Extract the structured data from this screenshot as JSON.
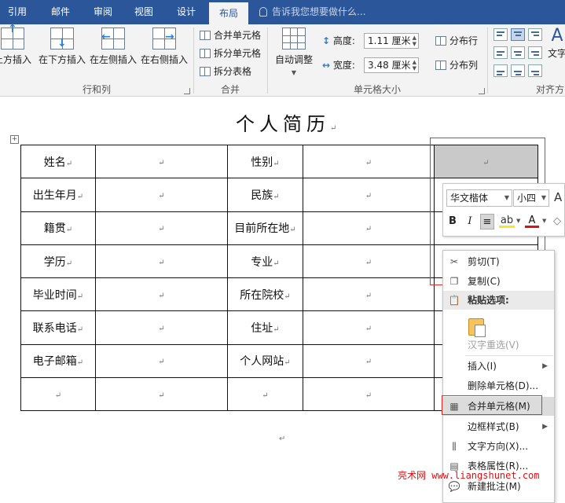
{
  "tabs": [
    "引用",
    "邮件",
    "审阅",
    "视图",
    "设计",
    "布局"
  ],
  "active_tab": "布局",
  "tell_me": "告诉我您想要做什么...",
  "ribbon": {
    "rows_cols": {
      "buttons": [
        "上方插入",
        "在下方插入",
        "在左侧插入",
        "在右侧插入"
      ],
      "label": "行和列"
    },
    "merge": {
      "items": [
        "合并单元格",
        "拆分单元格",
        "拆分表格"
      ],
      "label": "合并"
    },
    "cell_size": {
      "autofit": "自动调整",
      "height_label": "高度:",
      "height_value": "1.11 厘米",
      "width_label": "宽度:",
      "width_value": "3.48 厘米",
      "distribute_rows": "分布行",
      "distribute_cols": "分布列",
      "label": "单元格大小"
    },
    "alignment": {
      "text_direction": "文字",
      "label": "对齐方"
    }
  },
  "document": {
    "title": "个人简历",
    "para_mark": "↵",
    "table": [
      [
        "姓名",
        "",
        "性别",
        "",
        ""
      ],
      [
        "出生年月",
        "",
        "民族",
        "",
        ""
      ],
      [
        "籍贯",
        "",
        "目前所在地",
        "",
        ""
      ],
      [
        "学历",
        "",
        "专业",
        "",
        ""
      ],
      [
        "毕业时间",
        "",
        "所在院校",
        "",
        ""
      ],
      [
        "联系电话",
        "",
        "住址",
        "",
        ""
      ],
      [
        "电子邮箱",
        "",
        "个人网站",
        "",
        ""
      ],
      [
        "",
        "",
        "",
        "",
        ""
      ]
    ]
  },
  "mini_toolbar": {
    "font": "华文楷体",
    "size": "小四",
    "bold": "B",
    "italic": "I",
    "font_color": "A"
  },
  "context_menu": {
    "cut": "剪切(T)",
    "copy": "复制(C)",
    "paste_options": "粘贴选项:",
    "reconvert": "汉字重选(V)",
    "insert": "插入(I)",
    "delete_cells": "删除单元格(D)...",
    "merge_cells": "合并单元格(M)",
    "border_styles": "边框样式(B)",
    "text_direction": "文字方向(X)...",
    "table_properties": "表格属性(R)...",
    "new_comment": "新建批注(M)"
  },
  "watermark": "亮术网 www.liangshunet.com",
  "colors": {
    "tab_bar": "#2b579a",
    "highlight_box": "#e03030",
    "watermark": "#dd1111"
  }
}
